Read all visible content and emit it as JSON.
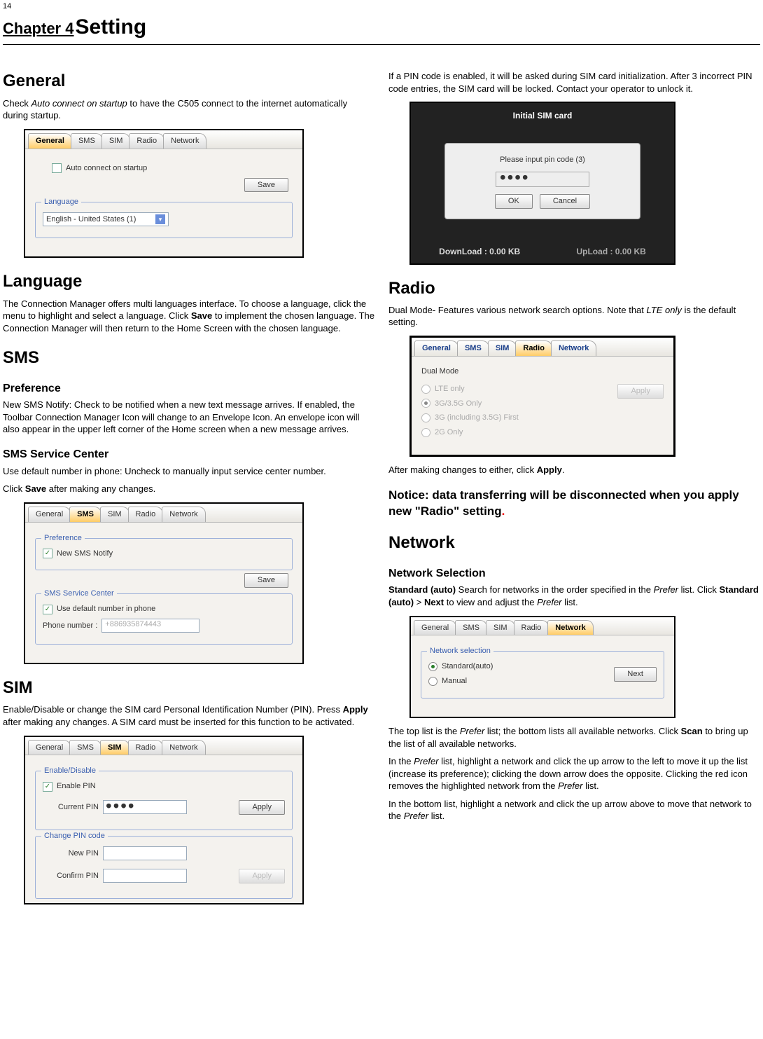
{
  "page_number": "14",
  "chapter_label": "Chapter 4",
  "chapter_title": "Setting",
  "tabs": {
    "general": "General",
    "sms": "SMS",
    "sim": "SIM",
    "radio": "Radio",
    "network": "Network"
  },
  "general": {
    "heading": "General",
    "body": "Check Auto connect on startup to have the C505 connect to the internet automatically during startup.",
    "checkbox_label": "Auto connect on startup",
    "save": "Save",
    "lang_legend": "Language",
    "lang_value": "English - United States (1)"
  },
  "language": {
    "heading": "Language",
    "body": "The Connection Manager offers multi languages interface. To choose a language, click the menu to highlight and select a language. Click Save to implement the chosen language. The Connection Manager will then return to the Home Screen with the chosen language."
  },
  "sms": {
    "heading": "SMS",
    "pref_heading": "Preference",
    "pref_body": "New SMS Notify: Check to be notified when a new text message arrives. If enabled, the Toolbar Connection Manager Icon will change to an Envelope Icon. An envelope icon will also appear in the upper left corner of the Home screen when a new message arrives.",
    "svc_heading": "SMS Service Center",
    "svc_body1": "Use default number in phone: Uncheck to manually input service center number.",
    "svc_body2_prefix": "Click ",
    "svc_body2_bold": "Save",
    "svc_body2_suffix": " after making any changes.",
    "pref_legend": "Preference",
    "pref_chk": "New SMS Notify",
    "svc_legend": "SMS Service Center",
    "svc_chk": "Use default number in phone",
    "phone_label": "Phone number :",
    "phone_value": "+886935874443",
    "save": "Save"
  },
  "sim": {
    "heading": "SIM",
    "body": "Enable/Disable or change the SIM card Personal Identification Number (PIN). Press Apply after making any changes. A SIM card must be inserted for this function to be activated.",
    "enable_legend": "Enable/Disable",
    "enable_chk": "Enable PIN",
    "curr_pin_label": "Current PIN",
    "curr_pin_value": "●●●●",
    "change_legend": "Change PIN code",
    "new_pin_label": "New PIN",
    "confirm_pin_label": "Confirm PIN",
    "apply": "Apply"
  },
  "pin_note": "If a PIN code is enabled, it will be asked during SIM card initialization. After 3 incorrect PIN code entries, the SIM card will be locked. Contact your operator to unlock it.",
  "pin_dlg": {
    "header": "Initial SIM card",
    "prompt": "Please input pin code (3)",
    "value": "●●●●",
    "ok": "OK",
    "cancel": "Cancel",
    "download": "DownLoad : 0.00 KB",
    "upload": "UpLoad : 0.00 KB"
  },
  "radio": {
    "heading": "Radio",
    "body_prefix": "Dual Mode- Features various network search options. Note that   ",
    "body_italic": "LTE only",
    "body_suffix": " is the default setting.",
    "mode_label": "Dual Mode",
    "opt_lte": "LTE only",
    "opt_3g": "3G/3.5G Only",
    "opt_3gfirst": "3G (including 3.5G) First",
    "opt_2g": "2G Only",
    "apply": "Apply",
    "after_prefix": "After making changes to either, click ",
    "after_bold": "Apply",
    "after_suffix": ".",
    "notice_prefix": "Notice:   data transferring will be disconnected when you apply new \"Radio\" setting",
    "notice_dot": "."
  },
  "network": {
    "heading": "Network",
    "sub_heading": "Network Selection",
    "p1_a": "Standard (auto)",
    "p1_b": " Search for networks in the order specified in the ",
    "p1_c": "Prefer",
    "p1_d": " list. Click ",
    "p1_e": "Standard (auto)",
    "p1_f": " > ",
    "p1_g": "Next",
    "p1_h": " to view and adjust the ",
    "p1_i": "Prefer",
    "p1_j": " list.",
    "sel_legend": "Network selection",
    "opt_std": "Standard(auto)",
    "opt_manual": "Manual",
    "next": "Next",
    "p2_a": "The top list is the ",
    "p2_b": "Prefer",
    "p2_c": " list; the bottom lists all available networks. Click ",
    "p2_d": "Scan",
    "p2_e": " to bring up the list of all available networks.",
    "p3_a": "In the ",
    "p3_b": "Prefer",
    "p3_c": " list, highlight a network and click the up arrow to the left to move it up the list (increase its preference); clicking the down arrow does the opposite. Clicking the red icon removes the highlighted network from the ",
    "p3_d": "Prefer",
    "p3_e": " list.",
    "p4_a": "In the bottom list, highlight a network and click the up arrow above to move that network to the ",
    "p4_b": "Prefer",
    "p4_c": " list."
  }
}
